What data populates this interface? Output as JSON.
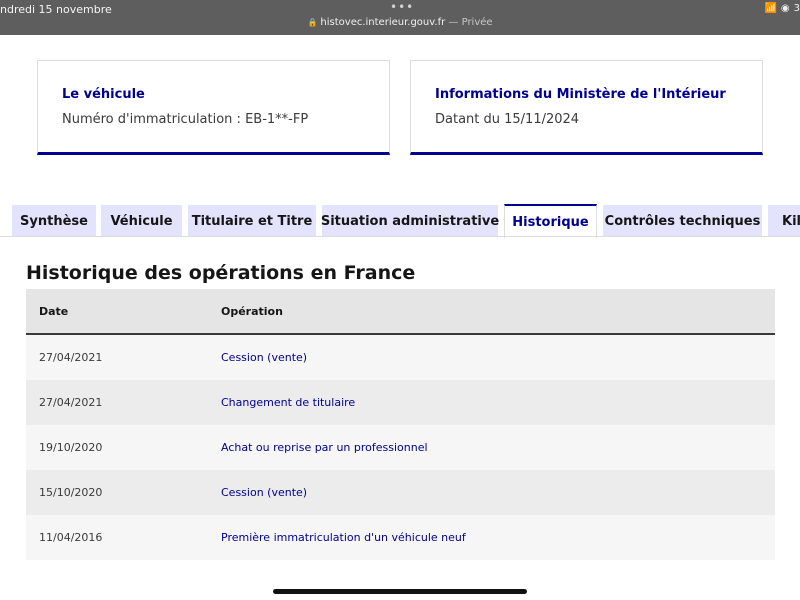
{
  "statusbar": {
    "date": "ndredi 15 novembre",
    "dots": "•••",
    "url": "histovec.interieur.gouv.fr",
    "private": "— Privée",
    "battery": "3"
  },
  "cards": {
    "vehicle": {
      "title": "Le véhicule",
      "text": "Numéro d'immatriculation : EB-1**-FP"
    },
    "ministry": {
      "title": "Informations du Ministère de l'Intérieur",
      "text": "Datant du 15/11/2024"
    }
  },
  "tabs": [
    {
      "label": "Synthèse"
    },
    {
      "label": "Véhicule"
    },
    {
      "label": "Titulaire et Titre"
    },
    {
      "label": "Situation administrative"
    },
    {
      "label": "Historique"
    },
    {
      "label": "Contrôles techniques"
    },
    {
      "label": "Kilo"
    }
  ],
  "active_tab": "Historique",
  "history": {
    "title": "Historique des opérations en France",
    "columns": {
      "date": "Date",
      "operation": "Opération"
    },
    "rows": [
      {
        "date": "27/04/2021",
        "operation": "Cession (vente)"
      },
      {
        "date": "27/04/2021",
        "operation": "Changement de titulaire"
      },
      {
        "date": "19/10/2020",
        "operation": "Achat ou reprise par un professionnel"
      },
      {
        "date": "15/10/2020",
        "operation": "Cession (vente)"
      },
      {
        "date": "11/04/2016",
        "operation": "Première immatriculation d'un véhicule neuf"
      }
    ]
  },
  "colors": {
    "accent": "#000091",
    "tab_bg": "#e3e3fd",
    "header_bg": "#e5e5e5",
    "status_bar": "#5e5e5e"
  }
}
